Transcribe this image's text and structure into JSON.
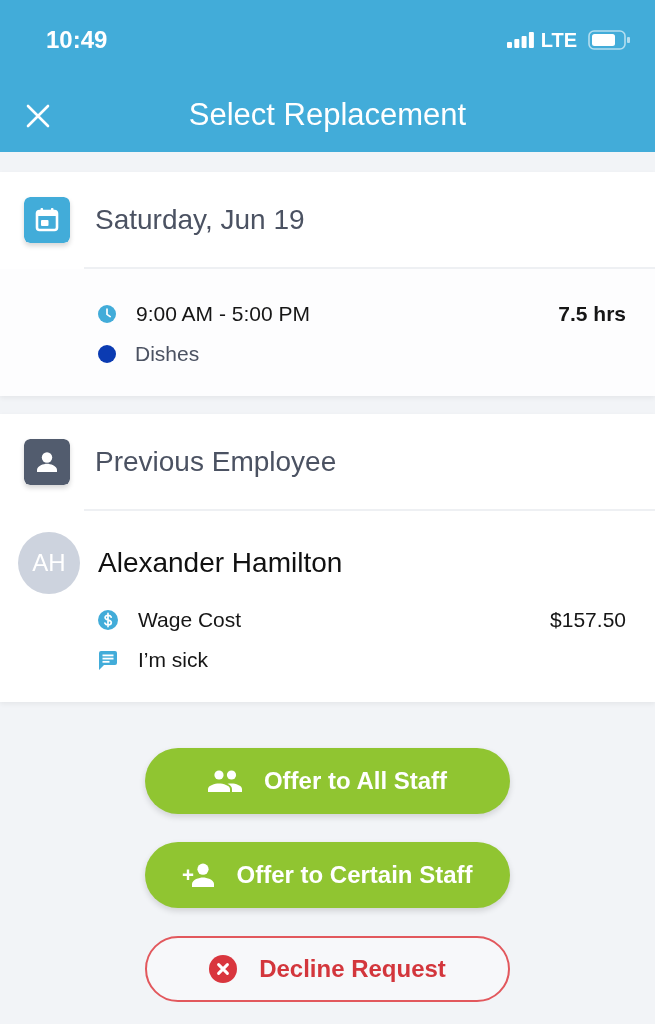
{
  "status_bar": {
    "time": "10:49",
    "network": "LTE"
  },
  "header": {
    "title": "Select Replacement"
  },
  "shift": {
    "date": "Saturday, Jun 19",
    "time_range": "9:00 AM - 5:00 PM",
    "duration": "7.5 hrs",
    "position": {
      "name": "Dishes",
      "color": "#0b3bb2"
    }
  },
  "previous_employee": {
    "heading": "Previous Employee",
    "initials": "AH",
    "name": "Alexander Hamilton",
    "wage_label": "Wage Cost",
    "wage_value": "$157.50",
    "note": "I’m sick"
  },
  "actions": [
    {
      "kind": "offer_all",
      "label": "Offer to All Staff"
    },
    {
      "kind": "offer_certain",
      "label": "Offer to Certain Staff"
    },
    {
      "kind": "decline",
      "label": "Decline Request"
    }
  ]
}
